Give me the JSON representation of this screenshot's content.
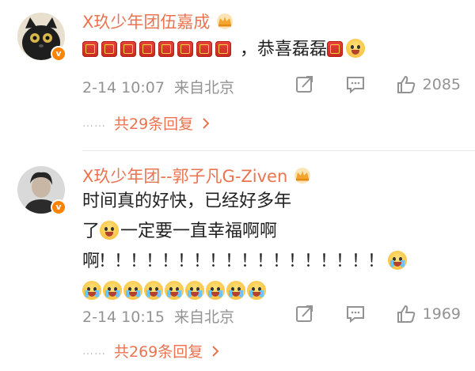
{
  "comments": [
    {
      "username": "X玖少年团伍嘉成",
      "text_suffix": "，恭喜磊磊",
      "date": "2-14 10:07",
      "location": "来自北京",
      "likes": "2085",
      "replies": "共29条回复",
      "dots": "……",
      "avatar_badge": "v"
    },
    {
      "username": "X玖少年团--郭子凡G-Ziven",
      "line1": "时间真的好快，已经好多年",
      "line2_a": "了",
      "line2_b": "一定要一直幸福啊啊",
      "line3": "啊！！！！！！！！！！！！！！！！！！",
      "date": "2-14 10:15",
      "location": "来自北京",
      "likes": "1969",
      "replies": "共269条回复",
      "dots": "……",
      "avatar_badge": "v"
    }
  ],
  "colors": {
    "username": "#eb7350",
    "meta": "#939393",
    "badge": "#ff8200"
  },
  "icons": [
    "crown-icon",
    "share-icon",
    "comment-icon",
    "like-icon",
    "chevron-right-icon",
    "verified-badge-icon"
  ]
}
